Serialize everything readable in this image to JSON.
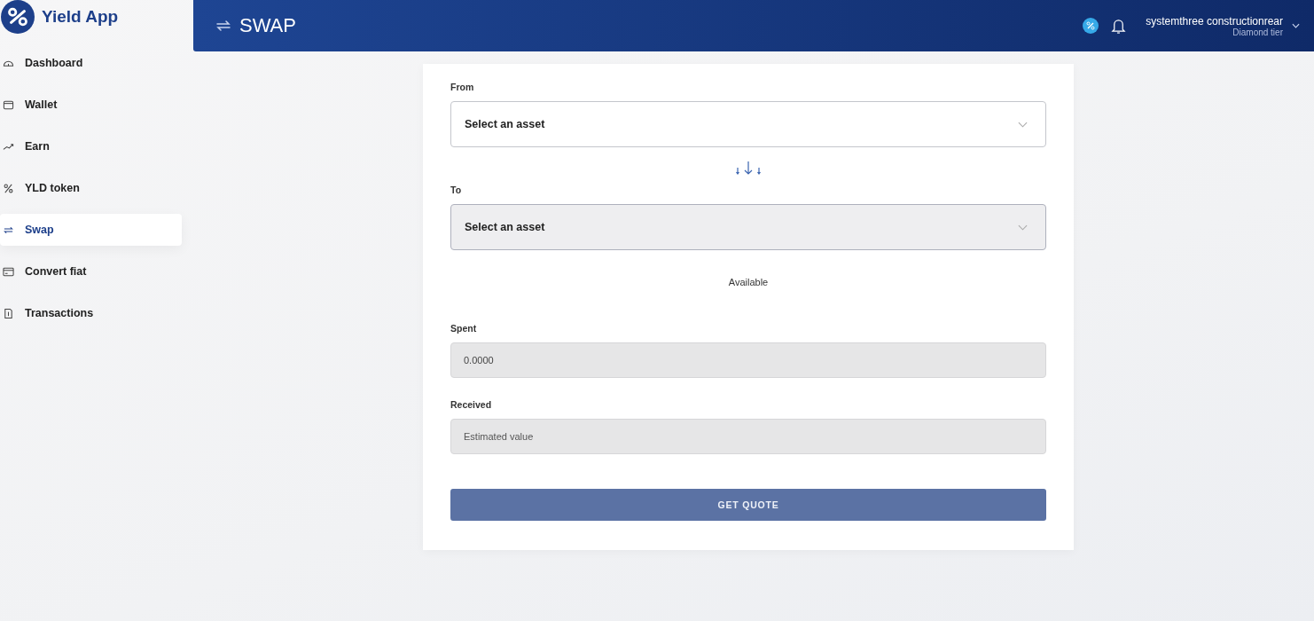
{
  "brand": {
    "name": "Yield App"
  },
  "sidebar": {
    "items": [
      {
        "label": "Dashboard",
        "selected": false
      },
      {
        "label": "Wallet",
        "selected": false
      },
      {
        "label": "Earn",
        "selected": false
      },
      {
        "label": "YLD token",
        "selected": false
      },
      {
        "label": "Swap",
        "selected": true
      },
      {
        "label": "Convert fiat",
        "selected": false
      },
      {
        "label": "Transactions",
        "selected": false
      }
    ]
  },
  "header": {
    "title": "SWAP",
    "user": {
      "name": "systemthree constructionrear",
      "tier": "Diamond tier"
    }
  },
  "form": {
    "from": {
      "label": "From",
      "placeholder": "Select an asset",
      "disabled": false
    },
    "to": {
      "label": "To",
      "placeholder": "Select an asset",
      "disabled": true
    },
    "available": "Available",
    "spent": {
      "label": "Spent",
      "value": "0.0000",
      "disabled": true
    },
    "received": {
      "label": "Received",
      "placeholder": "Estimated value",
      "disabled": true
    },
    "button": {
      "label": "GET QUOTE",
      "disabled": true
    }
  }
}
